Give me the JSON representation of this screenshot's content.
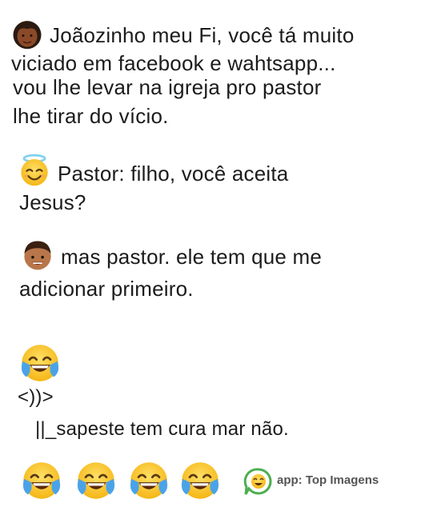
{
  "blocks": {
    "mother": {
      "emoji": "woman-face-emoji",
      "lines": [
        "Joãozinho meu Fi, você tá muito",
        "viciado em facebook e wahtsapp...",
        "vou lhe levar na igreja pro pastor",
        "lhe tirar do vício."
      ]
    },
    "pastor": {
      "emoji": "smiling-face-with-halo-emoji",
      "lines": [
        "Pastor: filho, você aceita",
        "Jesus?"
      ]
    },
    "boy": {
      "emoji": "boy-face-emoji",
      "lines": [
        "mas pastor. ele tem que me",
        "adicionar primeiro."
      ]
    },
    "reaction": {
      "emoji": "face-with-tears-of-joy-emoji",
      "lines": [
        "<))>",
        "||_sapeste tem cura mar não."
      ]
    }
  },
  "footer": {
    "emoji": "face-with-tears-of-joy-emoji",
    "emoji_count": 4,
    "app_icon": "top-imagens-logo-icon",
    "app_label": "app: Top Imagens"
  },
  "colors": {
    "text": "#1c1c1c",
    "emoji_yellow": "#f7c02b",
    "tears_blue": "#4aa3e8",
    "app_logo_green": "#4caf50"
  }
}
